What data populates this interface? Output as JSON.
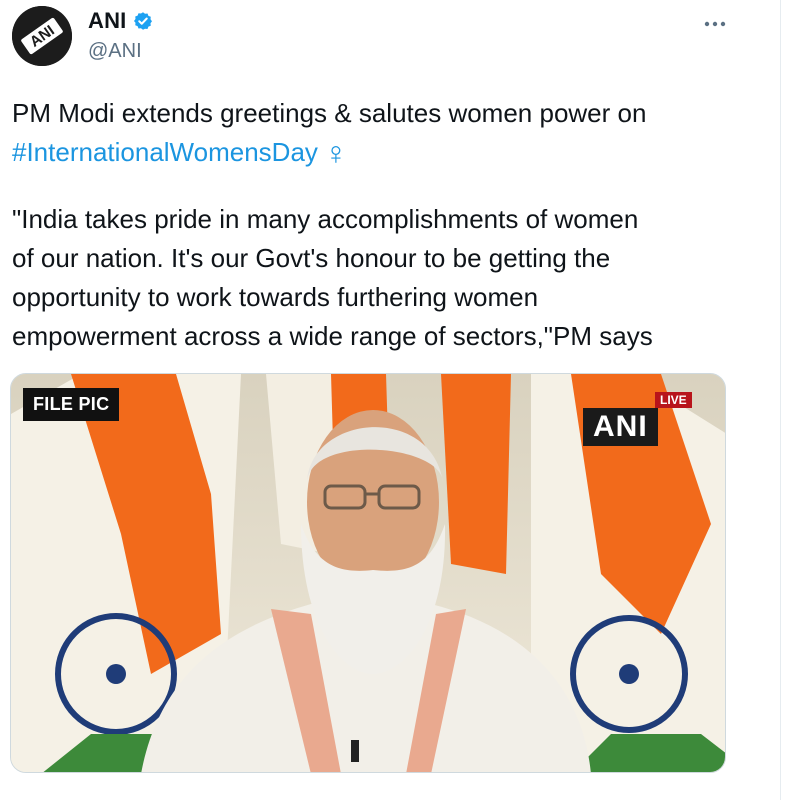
{
  "tweet": {
    "display_name": "ANI",
    "handle": "@ANI",
    "verified": true,
    "avatar_logo_text": "ANI",
    "text_line1": "PM Modi extends greetings & salutes women power on",
    "hashtag": "#InternationalWomensDay",
    "emoji": "♀",
    "quote_lines": [
      "\"India takes pride in many accomplishments of women",
      "of our nation. It's our Govt's honour to be getting the",
      "opportunity to work towards furthering women",
      "empowerment across a wide range of sectors,\"PM says"
    ]
  },
  "media": {
    "badge": "FILE PIC",
    "logo": "ANI",
    "live_label": "LIVE"
  },
  "colors": {
    "link": "#1b95e0",
    "verified": "#1da1f2",
    "saffron": "#f26a1b",
    "chakra_blue": "#1f3c78"
  },
  "icons": {
    "verified": "verified-badge-icon",
    "more": "more-options-icon"
  }
}
